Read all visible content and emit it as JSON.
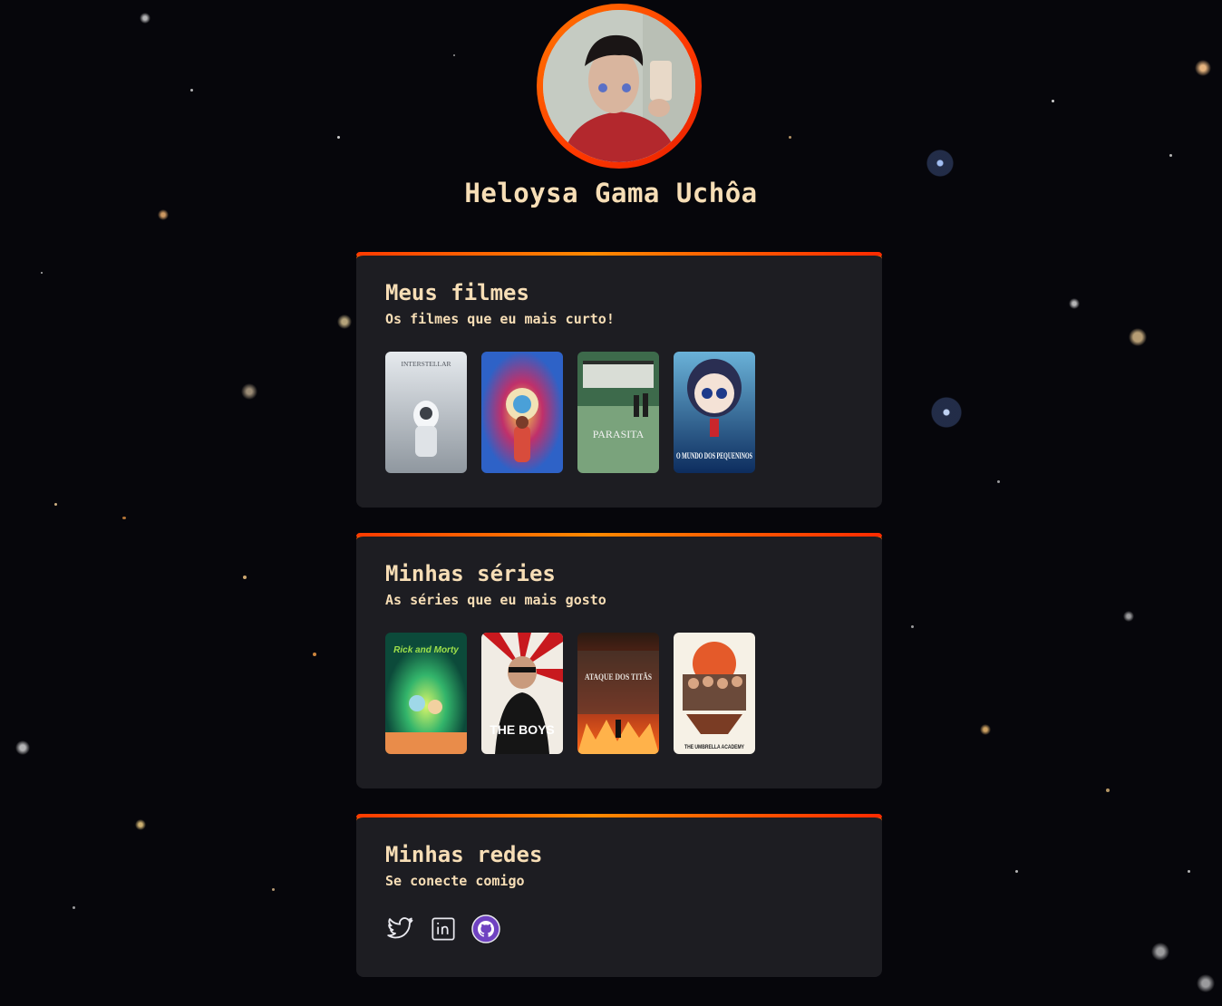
{
  "profile": {
    "name": "Heloysa Gama Uchôa",
    "avatar_icon": "profile-photo"
  },
  "movies": {
    "title": "Meus filmes",
    "subtitle": "Os filmes que eu mais curto!",
    "items": [
      {
        "poster_text": "INTERSTELLAR",
        "colors": [
          "#e6eaee",
          "#8f979f"
        ]
      },
      {
        "poster_text": "",
        "colors": [
          "#c0306a",
          "#2e62c7"
        ]
      },
      {
        "poster_text": "PARASITA",
        "colors": [
          "#3d6a4b",
          "#7aa37c"
        ]
      },
      {
        "poster_text": "O MUNDO DOS PEQUENINOS",
        "colors": [
          "#0d2d5e",
          "#6ab2d8"
        ]
      }
    ]
  },
  "series": {
    "title": "Minhas séries",
    "subtitle": "As séries que eu mais gosto",
    "items": [
      {
        "poster_text": "Rick and Morty",
        "colors": [
          "#0c6b4a",
          "#9ee04a"
        ]
      },
      {
        "poster_text": "THE BOYS",
        "colors": [
          "#c8191e",
          "#111111"
        ]
      },
      {
        "poster_text": "ATAQUE DOS TITÃS",
        "colors": [
          "#3a1a0c",
          "#ff6a1a"
        ]
      },
      {
        "poster_text": "THE UMBRELLA ACADEMY",
        "colors": [
          "#f6f1e6",
          "#d6452a"
        ]
      }
    ]
  },
  "social": {
    "title": "Minhas redes",
    "subtitle": "Se conecte comigo",
    "links": [
      {
        "icon": "twitter-icon"
      },
      {
        "icon": "linkedin-icon"
      },
      {
        "icon": "github-icon"
      }
    ]
  },
  "colors": {
    "accent_start": "#ff3b00",
    "accent_end": "#ff8a00",
    "text": "#f7deb6",
    "card_bg": "#1d1d22"
  }
}
